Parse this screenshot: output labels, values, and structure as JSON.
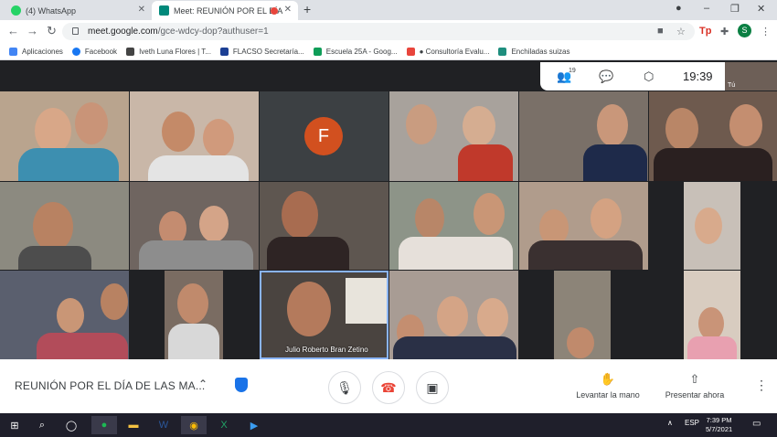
{
  "browser": {
    "tabs": [
      {
        "title": "(4) WhatsApp",
        "active": false
      },
      {
        "title": "Meet: REUNIÓN POR EL DÍA",
        "active": true
      }
    ],
    "url_host": "meet.google.com",
    "url_path": "/gce-wdcy-dop?authuser=1",
    "profile_initial": "S",
    "bookmarks": [
      {
        "label": "Aplicaciones",
        "icon": "apps-grid-icon",
        "color": "#4285f4"
      },
      {
        "label": "Facebook",
        "icon": "facebook-icon",
        "color": "#1877f2"
      },
      {
        "label": "Iveth Luna Flores | T...",
        "icon": "lambda-icon",
        "color": "#444444"
      },
      {
        "label": "FLACSO Secretaría...",
        "icon": "flacso-icon",
        "color": "#1c3f94"
      },
      {
        "label": "Escuela 25A - Goog...",
        "icon": "drive-icon",
        "color": "#0f9d58"
      },
      {
        "label": "● Consultoría Evalu...",
        "icon": "people-icon",
        "color": "#e8453c"
      },
      {
        "label": "Enchiladas suizas",
        "icon": "recipe-icon",
        "color": "#1e8e7e"
      }
    ]
  },
  "meet": {
    "participant_count": "19",
    "time": "19:39",
    "self_label": "Tú",
    "placeholder_initial": "F",
    "speaker_name": "Julio Roberto Bran Zetino",
    "meeting_title": "REUNIÓN POR EL DÍA DE LAS MA...",
    "actions": {
      "raise_hand": "Levantar la mano",
      "present_now": "Presentar ahora"
    }
  },
  "taskbar": {
    "language": "ESP",
    "time": "7:39 PM",
    "date": "5/7/2021"
  },
  "colors": {
    "meet_bg": "#202124",
    "end_call": "#ea4335",
    "placeholder_avatar": "#d2501f"
  }
}
